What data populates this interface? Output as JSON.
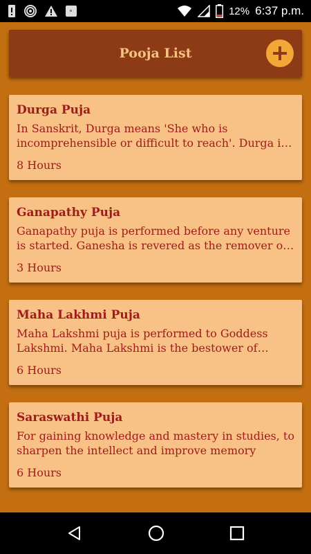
{
  "status_bar": {
    "battery": "12%",
    "time": "6:37 p.m."
  },
  "toolbar": {
    "title": "Pooja List"
  },
  "poojas": [
    {
      "title": "Durga Puja",
      "description": "In Sanskrit, Durga means 'She who is incomprehensible or difficult to reach'. Durga is a form of the Goddess",
      "duration": "8 Hours"
    },
    {
      "title": "Ganapathy Puja",
      "description": "Ganapathy puja is performed before any venture is started. Ganesha is revered as the remover of obstacles",
      "duration": "3 Hours"
    },
    {
      "title": "Maha Lakhmi Puja",
      "description": "Maha Lakshmi puja is  performed to Goddess Lakshmi. Maha Lakshmi is the bestower of wealth and prosperity",
      "duration": "6 Hours"
    },
    {
      "title": "Saraswathi Puja",
      "description": "For gaining knowledge and mastery in studies, to sharpen the intellect and improve memory",
      "duration": "6 Hours"
    }
  ],
  "colors": {
    "app_background": "#c36e10",
    "toolbar": "#8d3b16",
    "toolbar_text": "#f5c280",
    "card": "#f8c185",
    "card_text": "#a01c1c",
    "add_button": "#f2a737"
  },
  "icons": {
    "status_left": [
      "alert-icon",
      "hotspot-icon",
      "warning-icon",
      "notification-icon"
    ],
    "status_right": [
      "wifi-icon",
      "signal-icon",
      "battery-icon"
    ],
    "toolbar": "add-icon",
    "nav": [
      "back-icon",
      "home-icon",
      "recents-icon"
    ]
  }
}
